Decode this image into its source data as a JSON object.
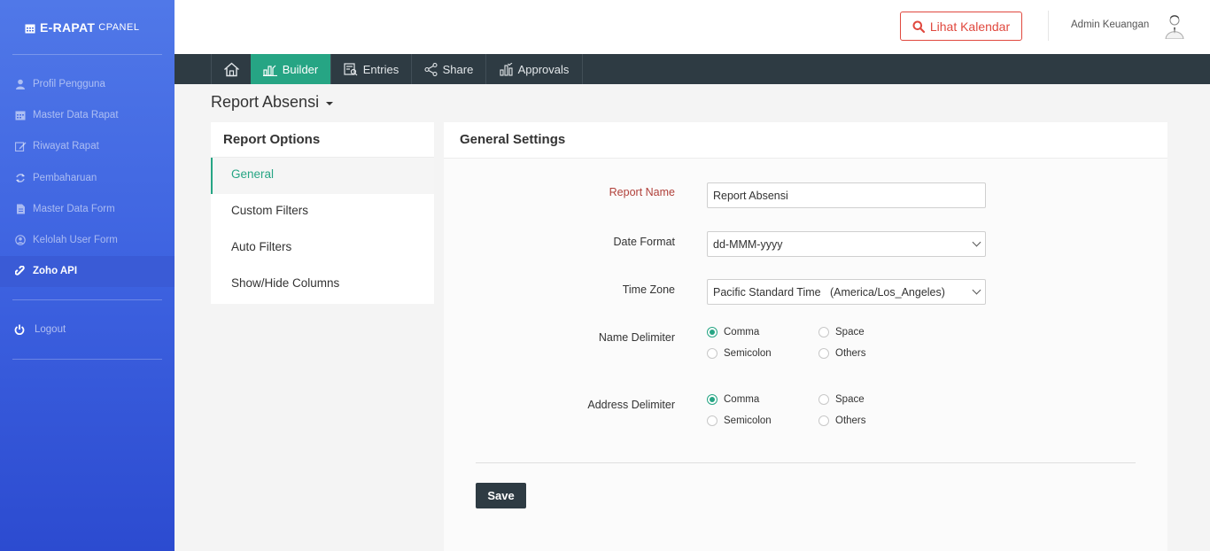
{
  "brand": {
    "name": "E-RAPAT",
    "suffix": "CPANEL"
  },
  "sidebar": {
    "items": [
      {
        "label": "Profil Pengguna",
        "icon": "user-icon"
      },
      {
        "label": "Master Data Rapat",
        "icon": "calendar-icon"
      },
      {
        "label": "Riwayat Rapat",
        "icon": "edit-icon"
      },
      {
        "label": "Pembaharuan",
        "icon": "refresh-icon"
      },
      {
        "label": "Master Data Form",
        "icon": "file-icon"
      },
      {
        "label": "Kelolah User Form",
        "icon": "user-circle-icon"
      },
      {
        "label": "Zoho API",
        "icon": "link-icon",
        "active": true
      }
    ],
    "logout": "Logout"
  },
  "topbar": {
    "calendar_button": "Lihat Kalendar",
    "user_name": "Admin Keuangan"
  },
  "nav": {
    "builder": "Builder",
    "entries": "Entries",
    "share": "Share",
    "approvals": "Approvals"
  },
  "page": {
    "title": "Report Absensi"
  },
  "options": {
    "title": "Report Options",
    "items": [
      "General",
      "Custom Filters",
      "Auto Filters",
      "Show/Hide Columns"
    ],
    "active": "General"
  },
  "settings": {
    "title": "General Settings",
    "report_name_label": "Report Name",
    "report_name_value": "Report Absensi",
    "date_format_label": "Date Format",
    "date_format_value": "dd-MMM-yyyy",
    "time_zone_label": "Time Zone",
    "time_zone_value": "Pacific Standard Time   (America/Los_Angeles)",
    "name_delimiter_label": "Name Delimiter",
    "address_delimiter_label": "Address Delimiter",
    "delimiter_options": [
      "Comma",
      "Space",
      "Semicolon",
      "Others"
    ],
    "name_delimiter_selected": "Comma",
    "address_delimiter_selected": "Comma",
    "save_label": "Save"
  },
  "colors": {
    "accent": "#26a584",
    "navbar": "#2e3b43",
    "sidebar": "#4a70e6",
    "danger": "#e0483e"
  }
}
